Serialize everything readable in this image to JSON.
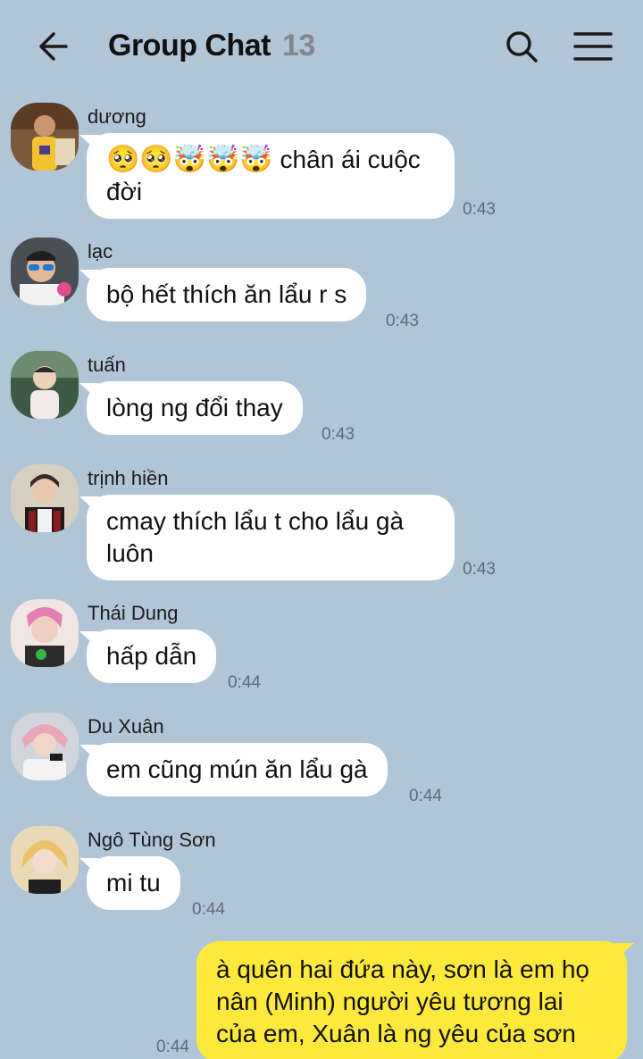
{
  "header": {
    "title": "Group Chat",
    "member_count": "13"
  },
  "messages": [
    {
      "sender": "dương",
      "text_emoji": "🥺🥺🤯🤯🤯",
      "text": " chân ái cuộc",
      "text_line2": "đời",
      "time": "0:43"
    },
    {
      "sender": "lạc",
      "text": "bộ hết thích ăn lẩu r s",
      "time": "0:43"
    },
    {
      "sender": "tuấn",
      "text": "lòng ng đổi thay",
      "time": "0:43"
    },
    {
      "sender": "trịnh hiền",
      "text": "cmay thích lẩu t cho lẩu gà",
      "text_line2": "luôn",
      "time": "0:43"
    },
    {
      "sender": "Thái Dung",
      "text": "hấp dẫn",
      "time": "0:44"
    },
    {
      "sender": "Du Xuân",
      "text": "em cũng mún ăn lẩu gà",
      "time": "0:44"
    },
    {
      "sender": "Ngô Tùng Sơn",
      "text": "mi tu",
      "time": "0:44"
    }
  ],
  "own_message": {
    "text": "à quên hai đứa này, sơn là em họ nân (Minh) người yêu tương lai của em, Xuân là ng yêu của sơn",
    "time": "0:44"
  },
  "colors": {
    "background": "#b1c5d8",
    "incoming_bubble": "#ffffff",
    "outgoing_bubble": "#fde93c"
  }
}
